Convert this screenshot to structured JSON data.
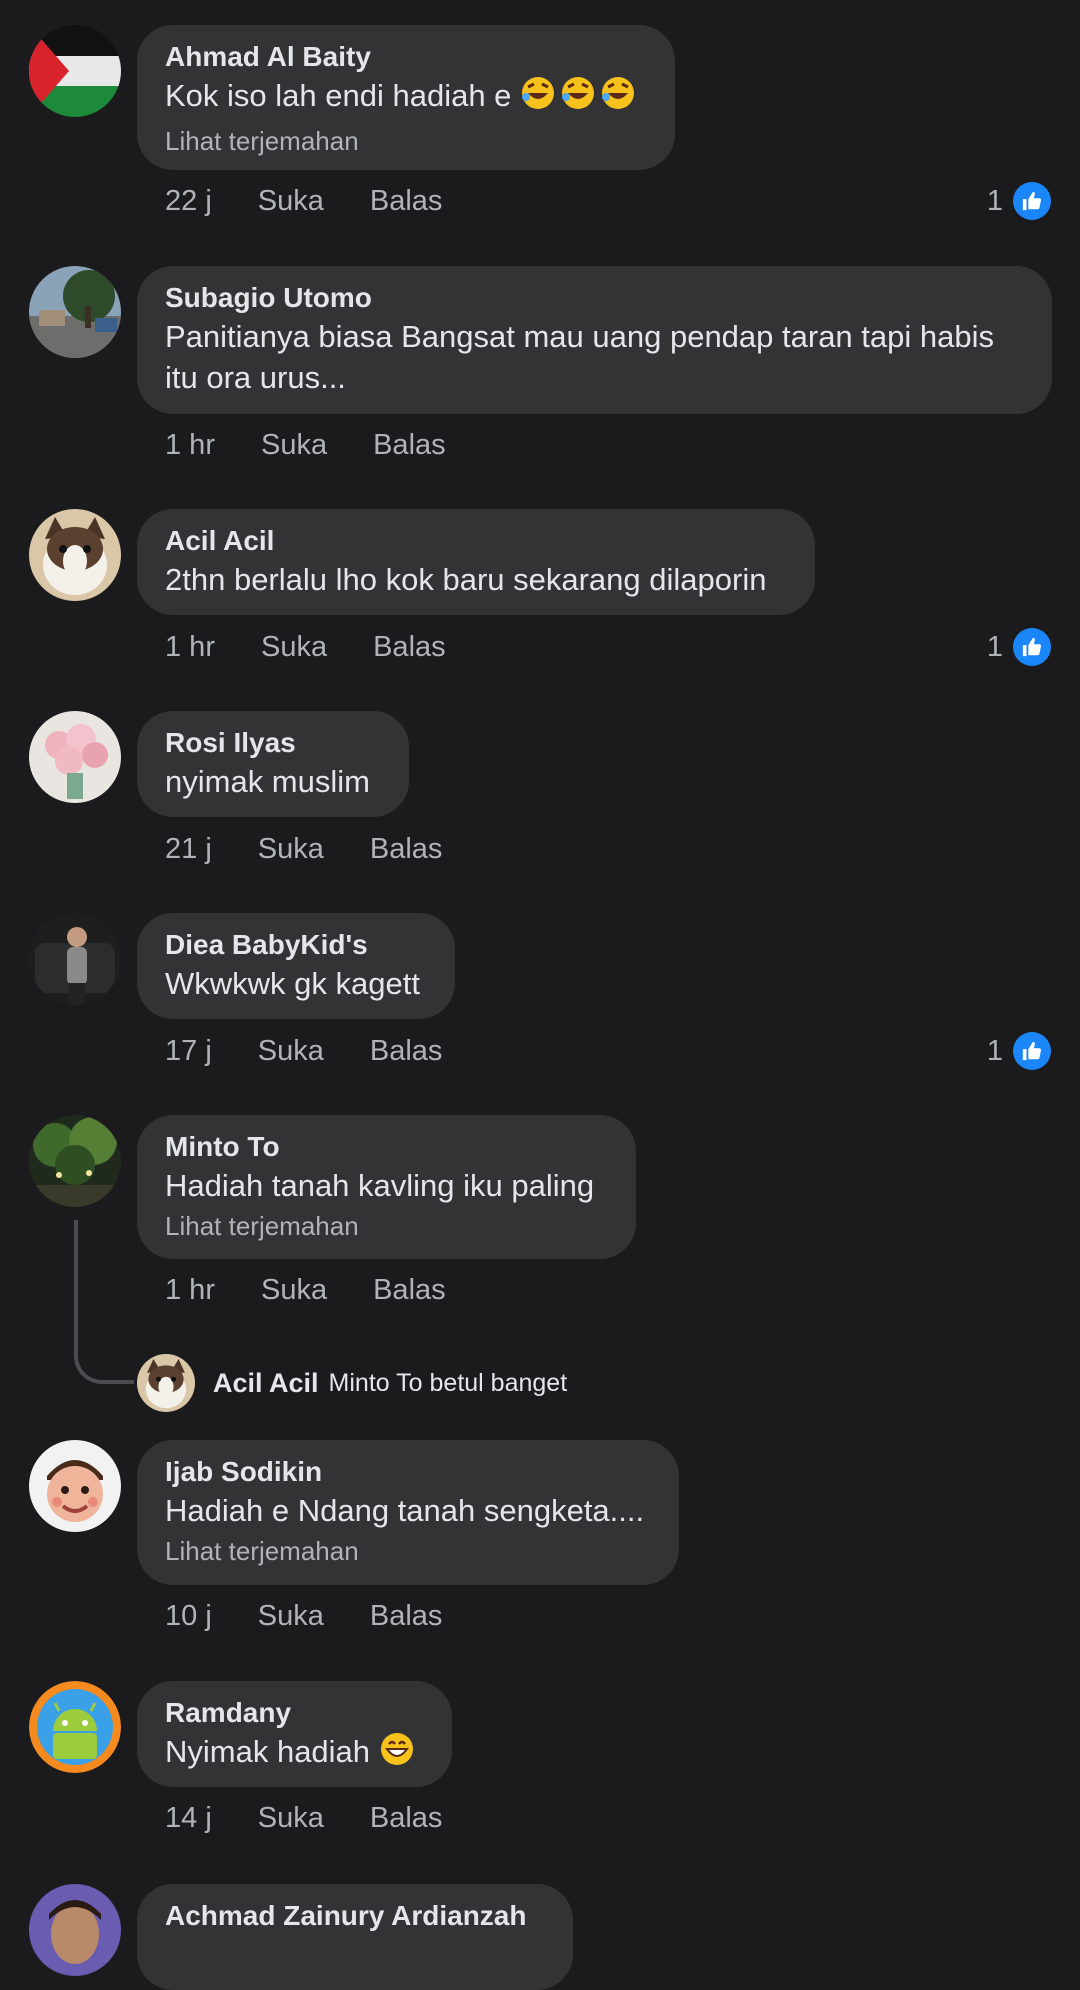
{
  "comments": [
    {
      "author": "Ahmad Al Baity",
      "text": "Kok iso lah endi hadiah e",
      "emoji": "rolling-laughing-x3",
      "translate": "Lihat terjemahan",
      "time": "22 j",
      "like": "Suka",
      "reply": "Balas",
      "likes": "1"
    },
    {
      "author": "Subagio Utomo",
      "text": "Panitianya biasa Bangsat mau uang pendap taran tapi habis itu ora urus...",
      "time": "1 hr",
      "like": "Suka",
      "reply": "Balas"
    },
    {
      "author": "Acil Acil",
      "text": "2thn berlalu lho kok baru sekarang dilaporin",
      "time": "1 hr",
      "like": "Suka",
      "reply": "Balas",
      "likes": "1"
    },
    {
      "author": "Rosi Ilyas",
      "text": "nyimak muslim",
      "time": "21 j",
      "like": "Suka",
      "reply": "Balas"
    },
    {
      "author": "Diea BabyKid's",
      "text": "Wkwkwk gk kagett",
      "time": "17 j",
      "like": "Suka",
      "reply": "Balas",
      "likes": "1"
    },
    {
      "author": "Minto To",
      "text": "Hadiah tanah kavling iku paling",
      "translate": "Lihat terjemahan",
      "time": "1 hr",
      "like": "Suka",
      "reply": "Balas"
    },
    {
      "author": "Ijab Sodikin",
      "text": "Hadiah e Ndang tanah sengketa....",
      "translate": "Lihat terjemahan",
      "time": "10 j",
      "like": "Suka",
      "reply": "Balas"
    },
    {
      "author": "Ramdany",
      "text": "Nyimak hadiah",
      "emoji": "grinning-face",
      "time": "14 j",
      "like": "Suka",
      "reply": "Balas"
    },
    {
      "author": "Achmad Zainury Ardianzah"
    }
  ],
  "reply": {
    "author": "Acil Acil",
    "text": "Minto To betul banget"
  },
  "colors": {
    "background": "#1b1b1d",
    "bubble": "#333335",
    "like_blue": "#1a86f7",
    "muted": "#b0b3b8"
  }
}
